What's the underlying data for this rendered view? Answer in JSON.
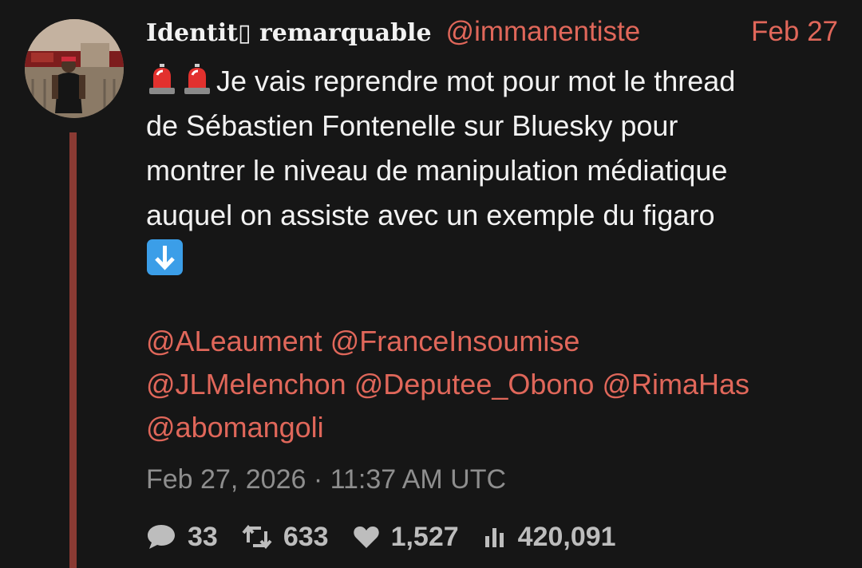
{
  "tweet": {
    "author": {
      "display_name": "Identit▯ remarquable",
      "handle": "@immanentiste"
    },
    "short_date": "Feb 27",
    "text_lines": [
      "Je vais reprendre mot pour mot le thread",
      "de Sébastien Fontenelle sur Bluesky pour",
      "montrer le niveau de manipulation médiatique",
      "auquel on assiste avec un exemple du figaro"
    ],
    "emojis": [
      "siren-emoji",
      "siren-emoji",
      "down-arrow-emoji"
    ],
    "mentions": [
      "@ALeaument",
      "@FranceInsoumise",
      "@JLMelenchon",
      "@Deputee_Obono",
      "@RimaHas",
      "@abomangoli"
    ],
    "timestamp": "Feb 27, 2026 · 11:37 AM UTC",
    "stats": {
      "replies": "33",
      "retweets": "633",
      "likes": "1,527",
      "views": "420,091"
    },
    "colors": {
      "background": "#161616",
      "accent": "#e0675a",
      "thread_line": "#8a3a33",
      "muted": "#8e8e8e"
    }
  }
}
